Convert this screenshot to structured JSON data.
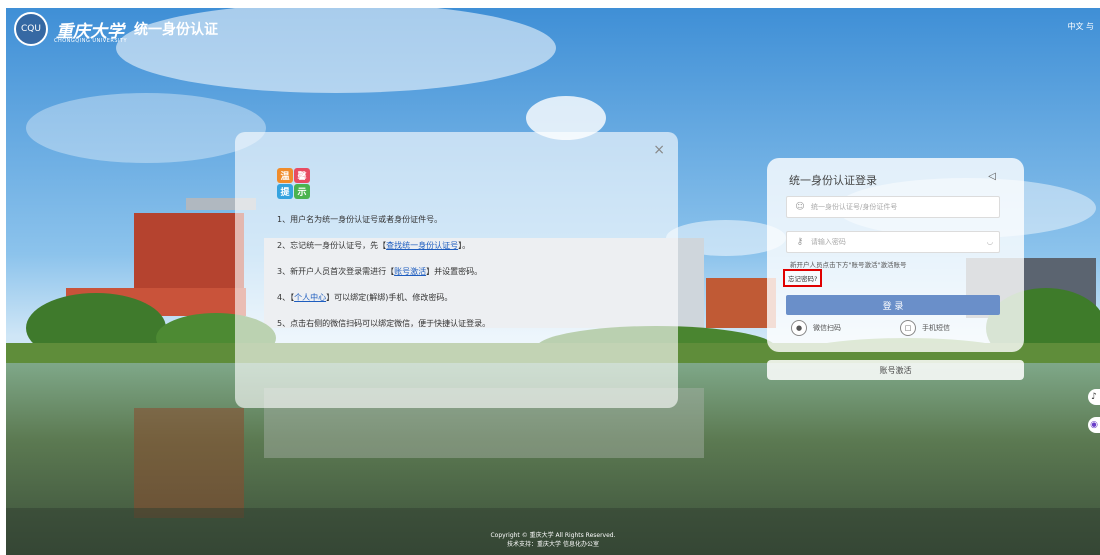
{
  "header": {
    "logo_seal": "CQU",
    "logo_name": "重庆大学",
    "logo_en": "CHONGQING UNIVERSITY",
    "system_title": "统一身份认证",
    "language": "中文 与"
  },
  "tips": {
    "badge": [
      "温",
      "馨",
      "提",
      "示"
    ],
    "close": "×",
    "items": [
      {
        "text": "1、用户名为统一身份认证号或者身份证件号。"
      },
      {
        "before": "2、忘记统一身份认证号，先【",
        "link": "查找统一身份认证号",
        "after": "】。"
      },
      {
        "before": "3、新开户人员首次登录需进行【",
        "link": "账号激活",
        "after": "】并设置密码。"
      },
      {
        "before": "4、【",
        "link": "个人中心",
        "after": "】可以绑定(解绑)手机、修改密码。"
      },
      {
        "text": "5、点击右侧的微信扫码可以绑定微信，便于快捷认证登录。"
      }
    ]
  },
  "login": {
    "title": "统一身份认证登录",
    "username_placeholder": "统一身份认证号/身份证件号",
    "password_placeholder": "请输入密码",
    "hint": "新开户人员点击下方\"账号激活\"激活账号",
    "forgot": "忘记密码?",
    "submit": "登 录",
    "wechat": "微信扫码",
    "sms": "手机短信"
  },
  "activate": "账号激活",
  "footer": {
    "copyright": "Copyright © 重庆大学 All Rights Reserved.",
    "support": "技术支持：重庆大学 信息化办公室"
  },
  "colors": {
    "login_button": "#6a8fc9",
    "forgot_highlight": "#e00000",
    "link": "#1e5dbf"
  }
}
